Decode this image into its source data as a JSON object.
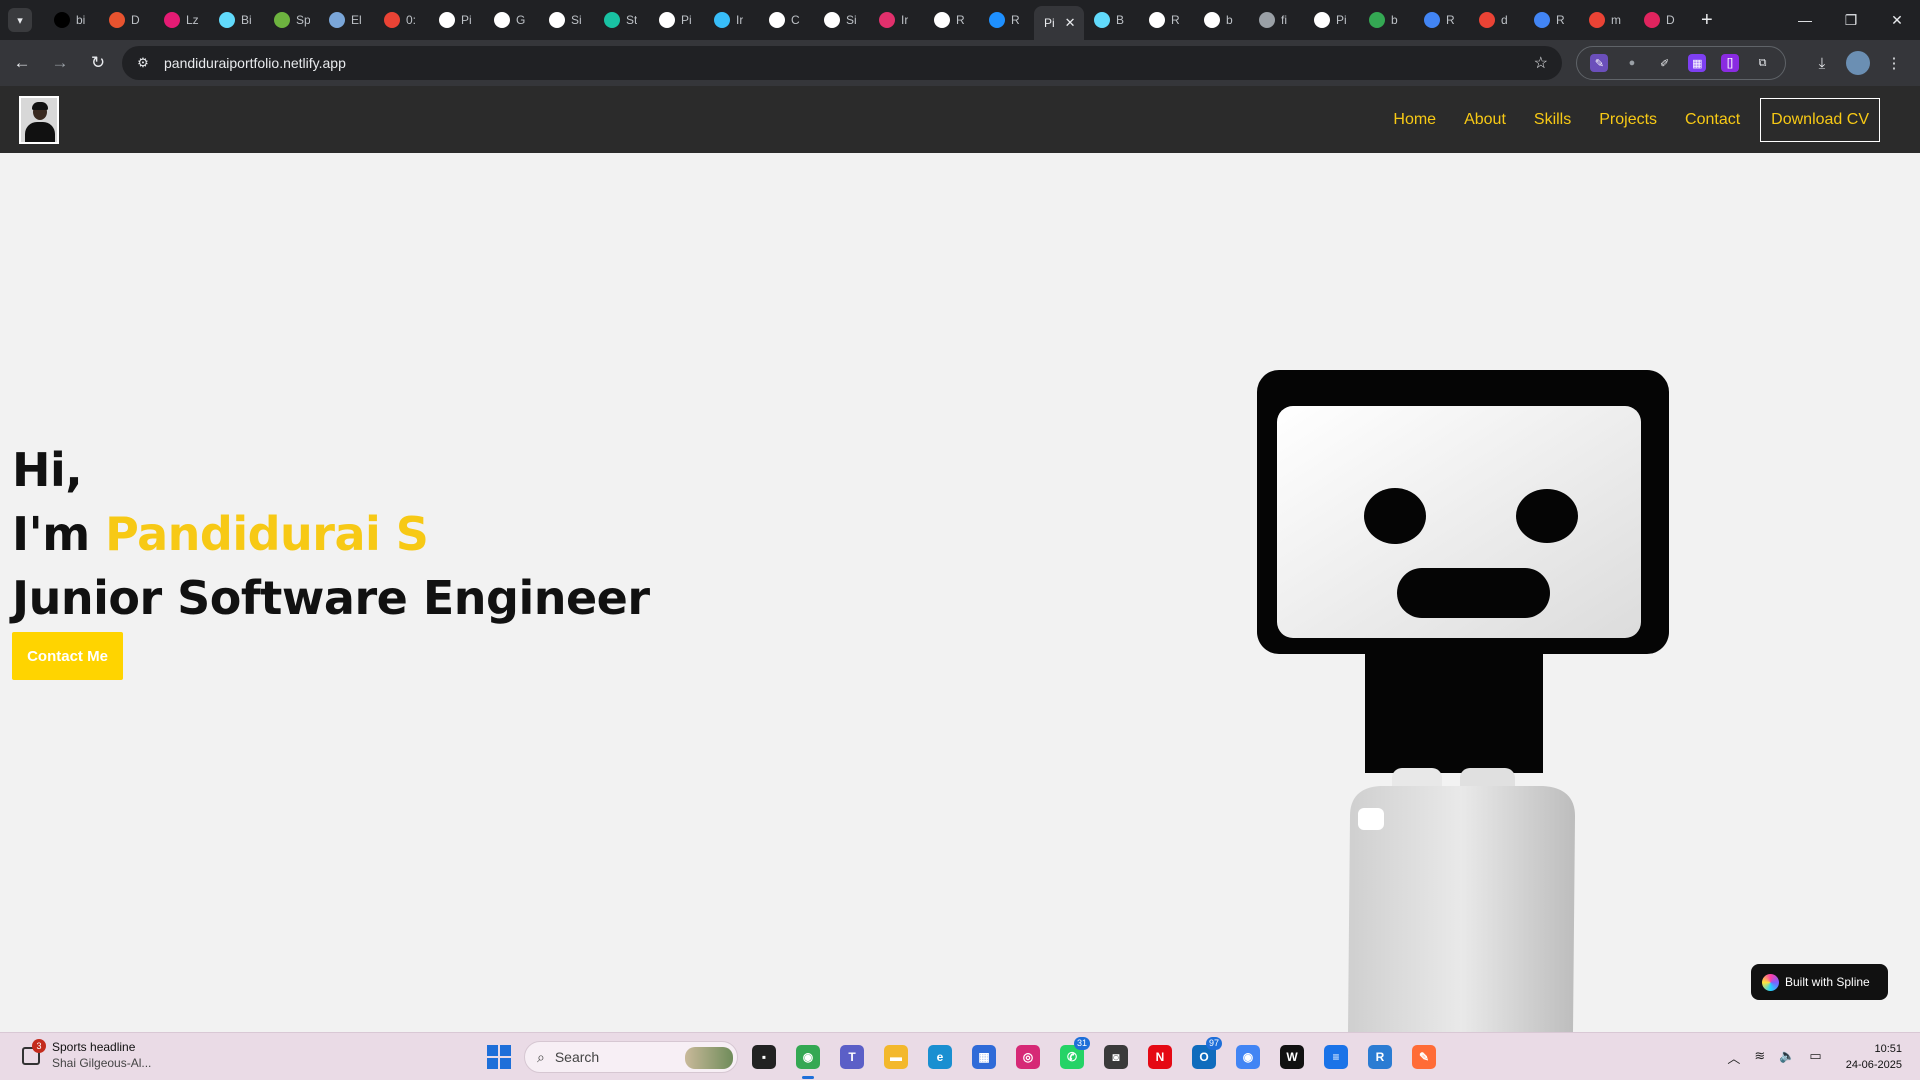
{
  "browser": {
    "tabs": [
      {
        "title": "bi",
        "icon": "ai-icon",
        "color": "#000000"
      },
      {
        "title": "D",
        "icon": "d-icon",
        "color": "#e8532f"
      },
      {
        "title": "Lz",
        "icon": "lz-icon",
        "color": "#e51b74"
      },
      {
        "title": "Bi",
        "icon": "react-icon",
        "color": "#61dafb"
      },
      {
        "title": "Sp",
        "icon": "spring-icon",
        "color": "#6db33f"
      },
      {
        "title": "El",
        "icon": "el-icon",
        "color": "#7aa6d9"
      },
      {
        "title": "0:",
        "icon": "gmail-icon",
        "color": "#ea4335"
      },
      {
        "title": "Pi",
        "icon": "github-icon",
        "color": "#ffffff"
      },
      {
        "title": "G",
        "icon": "openai-icon",
        "color": "#ffffff"
      },
      {
        "title": "Si",
        "icon": "slash-icon",
        "color": "#ffffff"
      },
      {
        "title": "St",
        "icon": "st-icon",
        "color": "#19c2a3"
      },
      {
        "title": "Pi",
        "icon": "github-icon",
        "color": "#ffffff"
      },
      {
        "title": "Ir",
        "icon": "tailwind-icon",
        "color": "#38bdf8"
      },
      {
        "title": "C",
        "icon": "openai-icon",
        "color": "#ffffff"
      },
      {
        "title": "Si",
        "icon": "slash-icon",
        "color": "#ffffff"
      },
      {
        "title": "Ir",
        "icon": "instagram-icon",
        "color": "#e1306c"
      },
      {
        "title": "R",
        "icon": "r-icon",
        "color": "#ffffff"
      },
      {
        "title": "R",
        "icon": "r-blue-icon",
        "color": "#1e90ff"
      },
      {
        "title": "Pi",
        "icon": "",
        "color": "#35363a",
        "active": true
      },
      {
        "title": "B",
        "icon": "react-icon",
        "color": "#61dafb"
      },
      {
        "title": "R",
        "icon": "openai-icon",
        "color": "#ffffff"
      },
      {
        "title": "b",
        "icon": "b-icon",
        "color": "#ffffff"
      },
      {
        "title": "fi",
        "icon": "globe-icon",
        "color": "#9aa0a6"
      },
      {
        "title": "Pi",
        "icon": "openai-icon",
        "color": "#ffffff"
      },
      {
        "title": "b",
        "icon": "b-green-icon",
        "color": "#34a853"
      },
      {
        "title": "R",
        "icon": "docs-icon",
        "color": "#4285f4"
      },
      {
        "title": "d",
        "icon": "google-icon",
        "color": "#ea4335"
      },
      {
        "title": "R",
        "icon": "docs-icon",
        "color": "#4285f4"
      },
      {
        "title": "m",
        "icon": "google-icon",
        "color": "#ea4335"
      },
      {
        "title": "D",
        "icon": "heart-icon",
        "color": "#e0245e"
      }
    ],
    "url": "pandiduraiportfolio.netlify.app"
  },
  "site": {
    "nav": {
      "items": [
        "Home",
        "About",
        "Skills",
        "Projects",
        "Contact"
      ],
      "cv_label": "Download CV"
    },
    "hero": {
      "greeting": "Hi,",
      "intro_prefix": "I'm ",
      "name": "Pandidurai S",
      "role": "Junior Software Engineer",
      "cta_label": "Contact Me"
    },
    "spline_badge": "Built with Spline",
    "accent_color": "#f7c915"
  },
  "taskbar": {
    "news_title": "Sports headline",
    "news_sub": "Shai Gilgeous-Al...",
    "news_badge": "3",
    "search_placeholder": "Search",
    "apps": [
      {
        "name": "terminal-icon",
        "color": "#222222",
        "glyph": "▪"
      },
      {
        "name": "chrome-icon",
        "color": "#34a853",
        "glyph": "◉",
        "active": true
      },
      {
        "name": "teams-icon",
        "color": "#5b5fc7",
        "glyph": "T"
      },
      {
        "name": "folder-icon",
        "color": "#f3b82c",
        "glyph": "▬"
      },
      {
        "name": "edge-icon",
        "color": "#1a8fd1",
        "glyph": "e"
      },
      {
        "name": "store-icon",
        "color": "#2f6bd8",
        "glyph": "▦"
      },
      {
        "name": "instagram-icon",
        "color": "#d62976",
        "glyph": "◎"
      },
      {
        "name": "whatsapp-icon",
        "color": "#25d366",
        "glyph": "✆",
        "badge": "31"
      },
      {
        "name": "camera-icon",
        "color": "#3a3a3a",
        "glyph": "◙"
      },
      {
        "name": "netflix-icon",
        "color": "#e50914",
        "glyph": "N"
      },
      {
        "name": "outlook-icon",
        "color": "#0f6cbd",
        "glyph": "O",
        "badge": "97"
      },
      {
        "name": "chrome-profile-icon",
        "color": "#4285f4",
        "glyph": "◉"
      },
      {
        "name": "w-app-icon",
        "color": "#111111",
        "glyph": "W"
      },
      {
        "name": "notepad-icon",
        "color": "#1a73e8",
        "glyph": "≡"
      },
      {
        "name": "rdp-icon",
        "color": "#2b7cd3",
        "glyph": "R"
      },
      {
        "name": "postman-icon",
        "color": "#ff6c37",
        "glyph": "✎"
      }
    ],
    "time": "10:51",
    "date": "24-06-2025"
  }
}
